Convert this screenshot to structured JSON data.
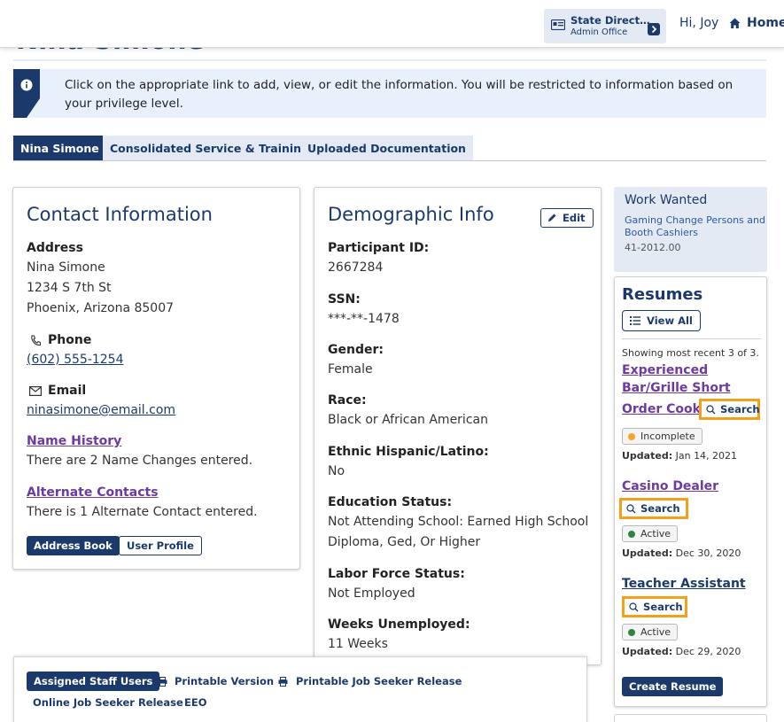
{
  "header": {
    "state_line1": "State Direct…",
    "state_line2": "Admin Office",
    "greeting": "Hi, Joy",
    "home_label": "Home"
  },
  "page": {
    "hidden_title": "Nina Simone"
  },
  "banner": {
    "text": "Click on the appropriate link to add, view, or edit the information. You will be restricted to information based on your privilege level."
  },
  "tabs": [
    {
      "label": "Nina Simone",
      "active": true
    },
    {
      "label": "Consolidated Service & Training",
      "active": false
    },
    {
      "label": "Uploaded Documentation",
      "active": false
    }
  ],
  "contact": {
    "title": "Contact Information",
    "address_label": "Address",
    "address_lines": [
      "Nina Simone",
      "1234 S 7th St",
      "Phoenix, Arizona 85007"
    ],
    "phone_label": "Phone",
    "phone_value": "(602) 555-1254",
    "email_label": "Email",
    "email_value": "ninasimone@email.com",
    "name_history_link": "Name History",
    "name_history_text": "There are 2 Name Changes entered.",
    "alt_contacts_link": "Alternate Contacts",
    "alt_contacts_text": "There is 1 Alternate Contact entered.",
    "address_book_label": "Address Book",
    "user_profile_label": "User Profile"
  },
  "demographic": {
    "title": "Demographic Info",
    "edit_label": "Edit",
    "fields": [
      {
        "label": "Participant ID:",
        "value": "2667284"
      },
      {
        "label": "SSN:",
        "value": "***-**-1478"
      },
      {
        "label": "Gender:",
        "value": "Female"
      },
      {
        "label": "Race:",
        "value": "Black or African American"
      },
      {
        "label": "Ethnic Hispanic/Latino:",
        "value": "No"
      },
      {
        "label": "Education Status:",
        "value": "Not Attending School: Earned High School",
        "value2": "Diploma, Ged, Or Higher"
      },
      {
        "label": "Labor Force Status:",
        "value": "Not Employed"
      },
      {
        "label": "Weeks Unemployed:",
        "value": "11 Weeks"
      }
    ]
  },
  "work_wanted": {
    "title": "Work Wanted",
    "description": "Gaming Change Persons and Booth Cashiers",
    "code": "41-2012.00"
  },
  "resumes": {
    "title": "Resumes",
    "view_all_label": "View All",
    "showing_text": "Showing most recent 3 of 3.",
    "items": [
      {
        "line1": "Experienced",
        "line2": "Bar/Grille Short",
        "line3": "Order Cook",
        "search_label": "Search",
        "status": "Incomplete",
        "status_color": "#f5a623",
        "updated_label": "Updated:",
        "updated_date": "Jan 14, 2021"
      },
      {
        "line1": "Casino Dealer",
        "search_label": "Search",
        "status": "Active",
        "status_color": "#2e8540",
        "updated_label": "Updated:",
        "updated_date": "Dec 30, 2020"
      },
      {
        "line1": "Teacher Assistant",
        "search_label": "Search",
        "status": "Active",
        "status_color": "#2e8540",
        "updated_label": "Updated:",
        "updated_date": "Dec 29, 2020"
      }
    ],
    "create_label": "Create Resume"
  },
  "actions": {
    "assigned_staff": "Assigned Staff Users",
    "printable_version": "Printable Version",
    "printable_release": "Printable Job Seeker Release",
    "online_release": "Online Job Seeker Release",
    "eeo": "EEO"
  },
  "colors": {
    "brand": "#1b3a6b",
    "link_purple": "#6c3aa0",
    "highlight": "#f5a01a"
  }
}
